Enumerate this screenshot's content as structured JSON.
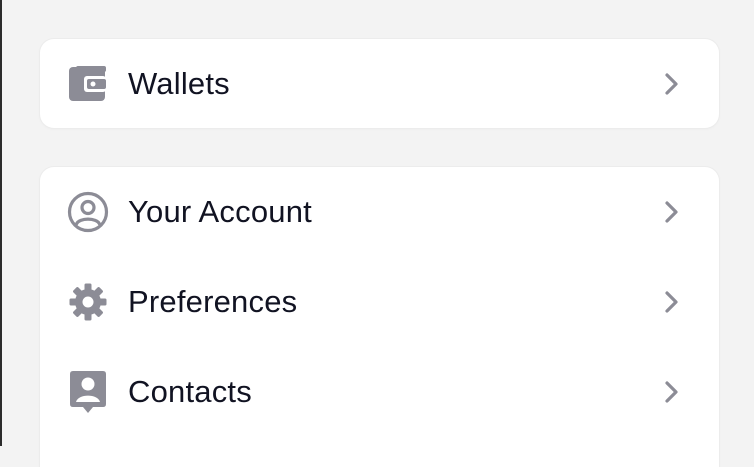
{
  "colors": {
    "icon": "#8c8c96",
    "text": "#111322",
    "chevron": "#8c8c96",
    "background": "#f3f3f3",
    "card": "#ffffff"
  },
  "wallets_card": {
    "items": [
      {
        "label": "Wallets",
        "icon": "wallet-icon"
      }
    ]
  },
  "account_card": {
    "items": [
      {
        "label": "Your Account",
        "icon": "user-circle-icon"
      },
      {
        "label": "Preferences",
        "icon": "gear-icon"
      },
      {
        "label": "Contacts",
        "icon": "contact-book-icon"
      }
    ]
  }
}
